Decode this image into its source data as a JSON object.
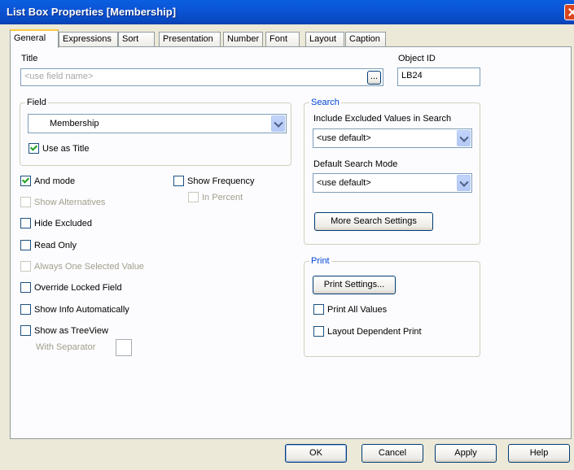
{
  "window": {
    "title": "List Box Properties [Membership]"
  },
  "tabs": [
    {
      "label": "General",
      "active": true
    },
    {
      "label": "Expressions"
    },
    {
      "label": "Sort"
    },
    {
      "label": "Presentation"
    },
    {
      "label": "Number"
    },
    {
      "label": "Font"
    },
    {
      "label": "Layout"
    },
    {
      "label": "Caption"
    }
  ],
  "general": {
    "title_label": "Title",
    "title_placeholder": "<use field name>",
    "title_browse": "...",
    "object_id_label": "Object ID",
    "object_id_value": "LB24",
    "field_group": "Field",
    "field_value": "Membership",
    "use_as_title": "Use as Title",
    "and_mode": "And mode",
    "show_alternatives": "Show Alternatives",
    "hide_excluded": "Hide Excluded",
    "read_only": "Read Only",
    "always_one_selected": "Always One Selected Value",
    "override_locked": "Override Locked Field",
    "show_info_auto": "Show Info Automatically",
    "show_as_treeview": "Show as TreeView",
    "with_separator": "With Separator",
    "show_frequency": "Show Frequency",
    "in_percent": "In Percent"
  },
  "search": {
    "group": "Search",
    "include_excluded_label": "Include Excluded Values in Search",
    "include_excluded_value": "<use default>",
    "default_mode_label": "Default Search Mode",
    "default_mode_value": "<use default>",
    "more_settings": "More Search Settings"
  },
  "print": {
    "group": "Print",
    "print_settings": "Print Settings...",
    "print_all_values": "Print All Values",
    "layout_dependent": "Layout Dependent Print"
  },
  "footer": {
    "ok": "OK",
    "cancel": "Cancel",
    "apply": "Apply",
    "help": "Help"
  },
  "state": {
    "use_as_title": true,
    "and_mode": true,
    "show_alternatives": false,
    "hide_excluded": false,
    "read_only": false,
    "always_one_selected": false,
    "override_locked": false,
    "show_info_auto": false,
    "show_as_treeview": false,
    "show_frequency": false,
    "in_percent": false,
    "print_all_values": false,
    "layout_dependent": false
  }
}
